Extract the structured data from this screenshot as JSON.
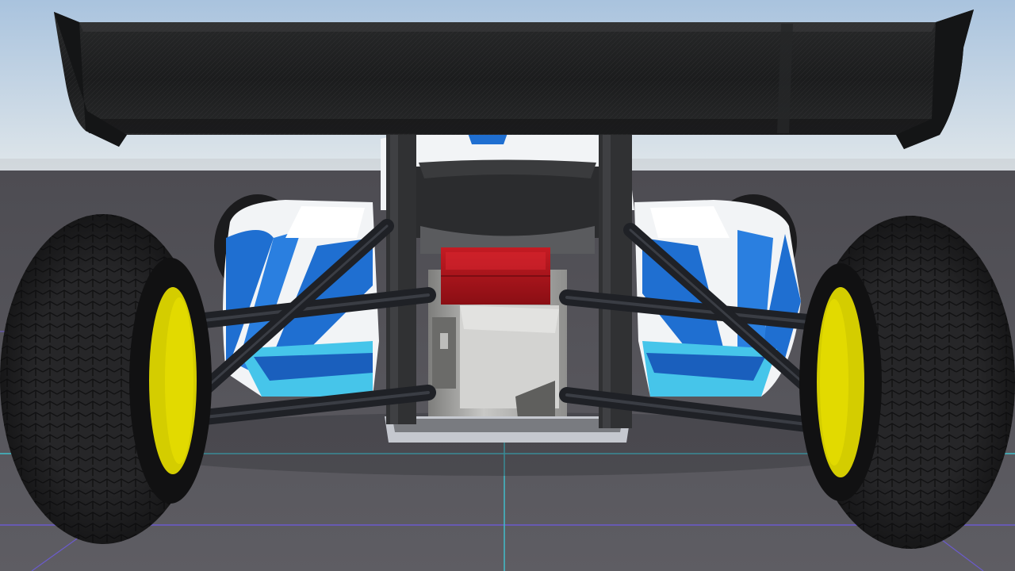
{
  "scene": {
    "type": "3d-viewport",
    "subject": "race-car-rear-view",
    "colors": {
      "sky_top": "#a9c3de",
      "sky_horizon": "#dfe6ea",
      "ground": "#5b5a60",
      "grid_cyan": "#3ec8d6",
      "grid_violet": "#6d5bd8",
      "wing": "#1e1f20",
      "tire": "#1c1c1e",
      "rim": "#d4cd00",
      "arm": "#1f2126",
      "body_white": "#f2f4f6",
      "body_blue": "#1f6fd1",
      "body_light_blue": "#46c5ea",
      "tail_light": "#b5121b",
      "engine_gray": "#a8a8a6"
    },
    "wheels": [
      "left-rear-wheel",
      "right-rear-wheel"
    ]
  }
}
